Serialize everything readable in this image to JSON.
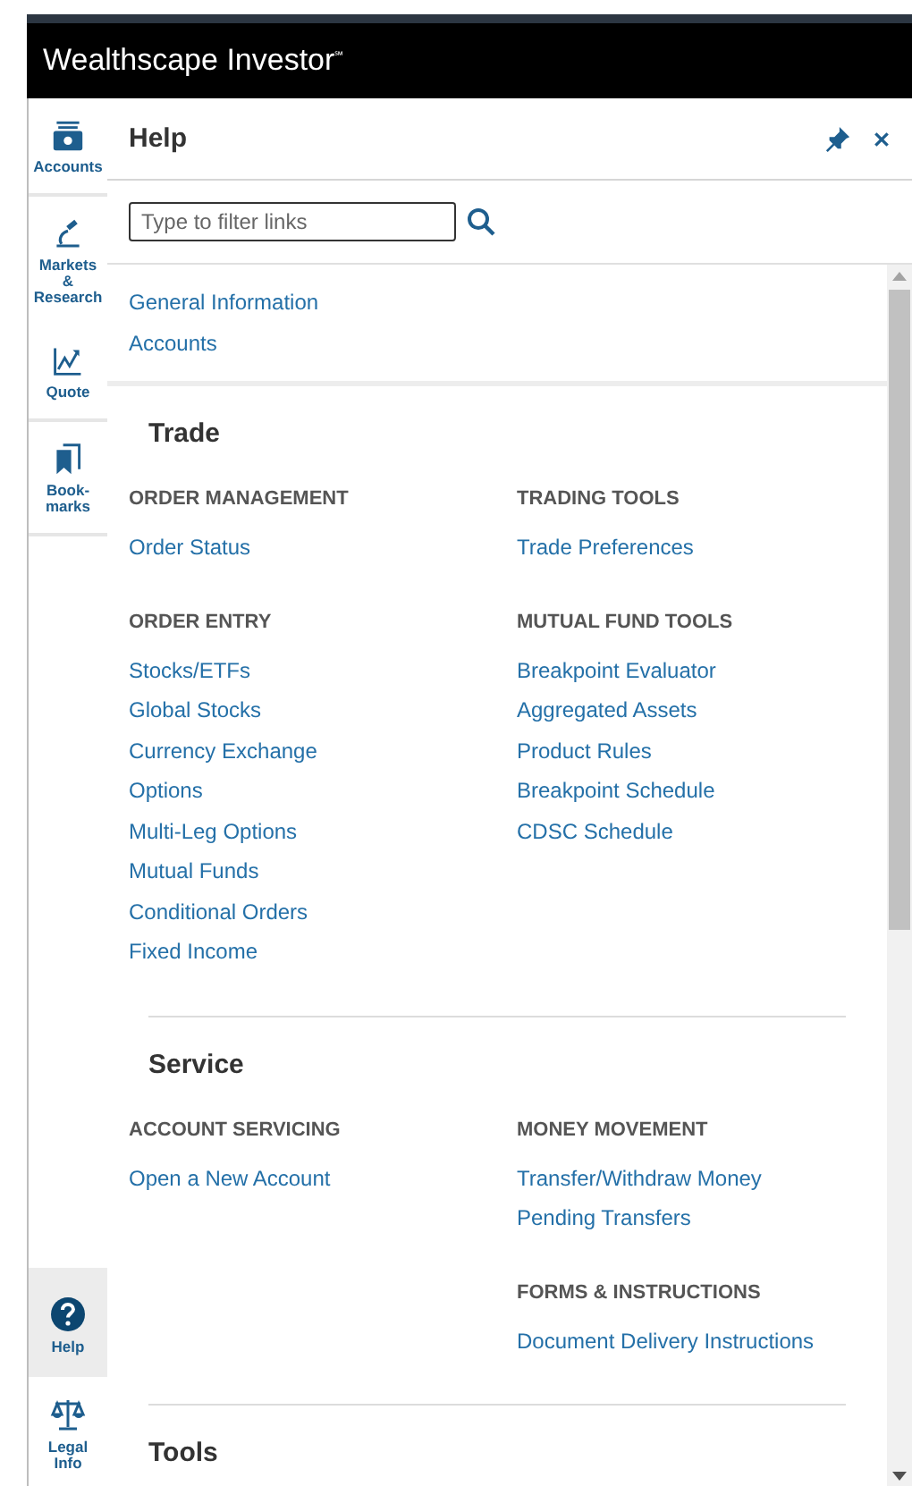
{
  "app": {
    "title": "Wealthscape Investor",
    "trademark": "℠"
  },
  "sidebar": {
    "groups": [
      [
        {
          "label": "Accounts",
          "kind": "accounts",
          "selected": false
        }
      ],
      [
        {
          "label": "Markets & Research",
          "kind": "microscope",
          "selected": false
        },
        {
          "label": "Quote",
          "kind": "chart",
          "selected": false
        }
      ],
      [
        {
          "label": "Book-marks",
          "kind": "bookmarks",
          "selected": false
        }
      ]
    ],
    "bottom_items": [
      {
        "label": "Help",
        "kind": "help",
        "selected": true
      },
      {
        "label": "Legal Info",
        "kind": "scales",
        "selected": false
      }
    ]
  },
  "panel": {
    "title": "Help",
    "search": {
      "placeholder": "Type to filter links"
    },
    "quick_links": [
      "General Information",
      "Accounts"
    ],
    "sections": [
      {
        "title": "Trade",
        "columns": [
          [
            {
              "heading": "ORDER MANAGEMENT",
              "links": [
                "Order Status"
              ]
            },
            {
              "heading": "ORDER ENTRY",
              "links": [
                "Stocks/ETFs",
                "Global Stocks",
                "Currency Exchange",
                "Options",
                "Multi-Leg Options",
                "Mutual Funds",
                "Conditional Orders",
                "Fixed Income"
              ]
            }
          ],
          [
            {
              "heading": "TRADING TOOLS",
              "links": [
                "Trade Preferences"
              ]
            },
            {
              "heading": "MUTUAL FUND TOOLS",
              "links": [
                "Breakpoint Evaluator",
                "Aggregated Assets",
                "Product Rules",
                "Breakpoint Schedule",
                "CDSC Schedule"
              ]
            }
          ]
        ]
      },
      {
        "title": "Service",
        "columns": [
          [
            {
              "heading": "ACCOUNT SERVICING",
              "links": [
                "Open a New Account"
              ]
            }
          ],
          [
            {
              "heading": "MONEY MOVEMENT",
              "links": [
                "Transfer/Withdraw Money",
                "Pending Transfers"
              ]
            },
            {
              "heading": "FORMS & INSTRUCTIONS",
              "links": [
                "Document Delivery Instructions"
              ]
            }
          ]
        ]
      },
      {
        "title": "Tools"
      }
    ]
  }
}
